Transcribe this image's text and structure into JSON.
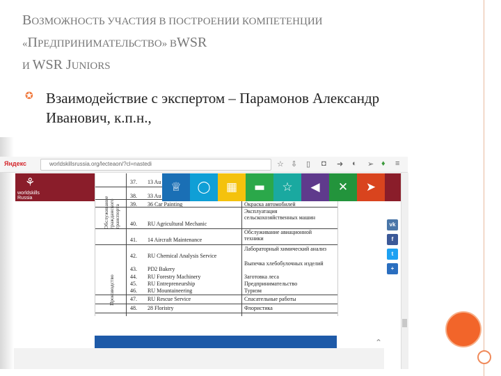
{
  "slide": {
    "title_parts": [
      "В",
      "ОЗМОЖНОСТЬ УЧАСТИЯ В ПОСТРОЕНИИ КОМПЕТЕНЦИИ «",
      "П",
      "РЕДПРИНИМАТЕЛЬСТВО» В",
      "WSR",
      " И ",
      "WSR J",
      "UNIORS"
    ],
    "bullet_text": "Взаимодействие с экспертом – Парамонов Александр Иванович, к.п.н.,"
  },
  "browser": {
    "yandex_label": "Яндекс",
    "url": "worldskillsrussia.org/lecteaon/?cl=nastedi",
    "icons": [
      "star-icon",
      "download-icon",
      "bookmark-icon",
      "pocket-icon",
      "forward-icon",
      "chat-icon",
      "telegram-icon",
      "leaf-icon",
      "menu-icon"
    ]
  },
  "site": {
    "logo_text": "worldskills Russia",
    "nav_colors": [
      "#1a6fb5",
      "#0f9fd6",
      "#f4c20d",
      "#2ba84a",
      "#1aa9a0",
      "#5f3a8c",
      "#23943c",
      "#d9441e"
    ],
    "nav_icons": [
      "trophy-icon",
      "chat-bubble-icon",
      "calendar-icon",
      "briefcase-icon",
      "star-icon",
      "megaphone-icon",
      "tools-icon",
      "paper-plane-icon"
    ],
    "nav_glyphs": [
      "♕",
      "◯",
      "▦",
      "▬",
      "☆",
      "◀",
      "✕",
      "➤"
    ],
    "social": [
      {
        "name": "vk-icon",
        "label": "vk",
        "color": "#4a76a8"
      },
      {
        "name": "facebook-icon",
        "label": "f",
        "color": "#3b5998"
      },
      {
        "name": "twitter-icon",
        "label": "t",
        "color": "#1da1f2"
      },
      {
        "name": "share-plus-icon",
        "label": "+",
        "color": "#2a6ebf"
      }
    ]
  },
  "table": {
    "group1_label": "Обслуживание гражданского транспорта",
    "group2_label": "Производство",
    "rows": [
      {
        "num": "37.",
        "name": "13 Au",
        "ru": ""
      },
      {
        "num": "38.",
        "name": "33 Au",
        "ru": ""
      },
      {
        "num": "39.",
        "name": "36 Car Painting",
        "ru": "Окраска автомобилей"
      },
      {
        "num": "40.",
        "name": "RU Agricultural Mechanic",
        "ru": "Эксплуатация сельскохозяйственных машин"
      },
      {
        "num": "41.",
        "name": "14 Aircraft Maintenance",
        "ru": "Обслуживание авиационной техники"
      },
      {
        "num": "42.",
        "name": "RU Chemical Analysis Service",
        "ru": "Лабораторный химический анализ"
      },
      {
        "num": "43.",
        "name": "PD2 Bakery",
        "ru": "Выпечка хлебобулочных изделий"
      },
      {
        "num": "44.",
        "name": "RU Forestry Machinery",
        "ru": "Заготовка леса"
      },
      {
        "num": "45.",
        "name": "RU Entrepreneurship",
        "ru": "Предпринимательство"
      },
      {
        "num": "46.",
        "name": "RU Mountaineering",
        "ru": "Туризм"
      },
      {
        "num": "47.",
        "name": "RU Rescue Service",
        "ru": "Спасательные работы"
      },
      {
        "num": "48.",
        "name": "28 Floristry",
        "ru": "Флористика"
      }
    ]
  }
}
